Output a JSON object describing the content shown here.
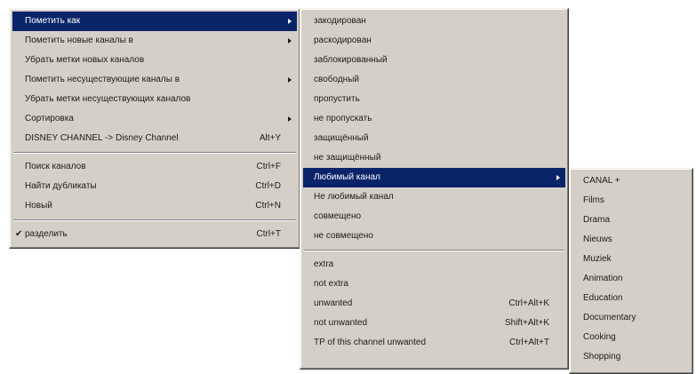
{
  "menu_main": {
    "items": [
      {
        "label": "Пометить как",
        "submenu": true
      },
      {
        "label": "Пометить новые каналы в",
        "submenu": true
      },
      {
        "label": "Убрать метки новых каналов"
      },
      {
        "label": "Пометить несуществующие каналы в",
        "submenu": true
      },
      {
        "label": "Убрать метки несуществующих каналов"
      },
      {
        "label": "Сортировка",
        "submenu": true
      },
      {
        "label": "DISNEY CHANNEL -> Disney Channel",
        "shortcut": "Alt+Y"
      }
    ],
    "items2": [
      {
        "label": "Поиск каналов",
        "shortcut": "Ctrl+F"
      },
      {
        "label": "Найти дубликаты",
        "shortcut": "Ctrl+D"
      },
      {
        "label": "Новый",
        "shortcut": "Ctrl+N"
      }
    ],
    "items3": [
      {
        "label": "разделить",
        "shortcut": "Ctrl+T",
        "check": "✔"
      }
    ]
  },
  "menu_mark": {
    "items": [
      {
        "label": "закодирован"
      },
      {
        "label": "раскодирован"
      },
      {
        "label": "заблокированный"
      },
      {
        "label": "свободный"
      },
      {
        "label": "пропустить"
      },
      {
        "label": "не пропускать"
      },
      {
        "label": "защищённый"
      },
      {
        "label": "не защищённый"
      },
      {
        "label": "Любимый канал",
        "submenu": true
      },
      {
        "label": "Не любимый канал"
      },
      {
        "label": "совмещено"
      },
      {
        "label": "не совмещено"
      }
    ],
    "items2": [
      {
        "label": "extra"
      },
      {
        "label": "not extra"
      },
      {
        "label": "unwanted",
        "shortcut": "Ctrl+Alt+K"
      },
      {
        "label": "not unwanted",
        "shortcut": "Shift+Alt+K"
      },
      {
        "label": "TP of this channel unwanted",
        "shortcut": "Ctrl+Alt+T"
      }
    ]
  },
  "menu_fav": {
    "items": [
      {
        "label": "CANAL +"
      },
      {
        "label": "Films"
      },
      {
        "label": "Drama"
      },
      {
        "label": "Nieuws"
      },
      {
        "label": "Muziek"
      },
      {
        "label": "Animation"
      },
      {
        "label": "Education"
      },
      {
        "label": "Documentary"
      },
      {
        "label": "Cooking"
      },
      {
        "label": "Shopping"
      }
    ]
  }
}
